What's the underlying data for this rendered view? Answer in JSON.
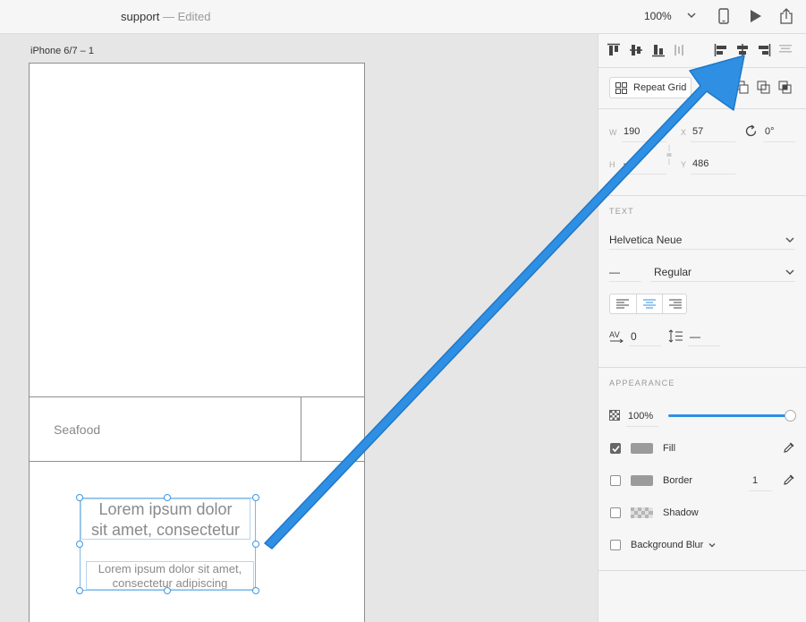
{
  "titlebar": {
    "doc_name": "support",
    "doc_status": " — Edited",
    "zoom": "100%"
  },
  "canvas": {
    "artboard_label": "iPhone 6/7 – 1",
    "cell_label": "Seafood",
    "lorem_title_line1": "Lorem ipsum dolor",
    "lorem_title_line2": "sit amet, consectetur",
    "lorem_body_line1": "Lorem ipsum dolor sit amet,",
    "lorem_body_line2": "consectetur adipiscing"
  },
  "inspector": {
    "repeat_grid_label": "Repeat Grid",
    "dims": {
      "w_label": "W",
      "w_value": "190",
      "x_label": "X",
      "x_value": "57",
      "h_label": "H",
      "h_value": "—",
      "y_label": "Y",
      "y_value": "486",
      "rotation": "0°"
    },
    "text": {
      "section_title": "TEXT",
      "font_family": "Helvetica Neue",
      "font_size": "—",
      "font_weight": "Regular",
      "char_spacing": "0",
      "line_spacing": "—"
    },
    "appearance": {
      "section_title": "APPEARANCE",
      "opacity": "100%",
      "opacity_fraction": 1.0,
      "fill_label": "Fill",
      "border_label": "Border",
      "border_width": "1",
      "shadow_label": "Shadow",
      "blur_label": "Background Blur"
    }
  },
  "colors": {
    "accent": "#2f8fe3",
    "fill_swatch": "#9b9b9b",
    "border_swatch": "#9b9b9b"
  }
}
